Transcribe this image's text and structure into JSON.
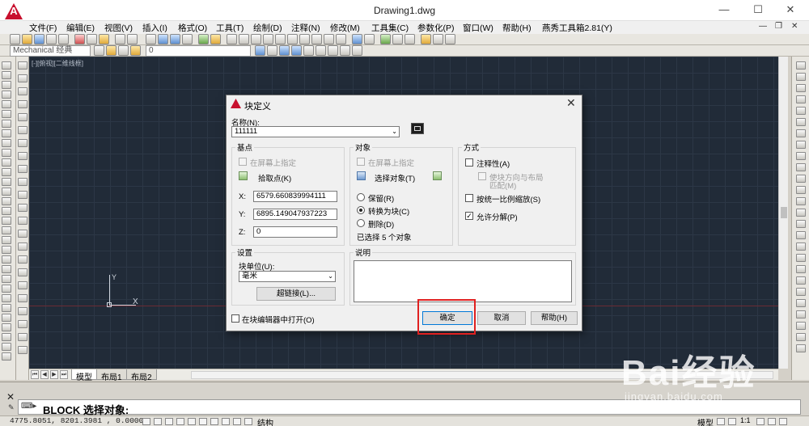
{
  "window": {
    "title": "Drawing1.dwg",
    "minimize": "—",
    "maximize": "☐",
    "close": "✕",
    "logo": "A"
  },
  "menu": {
    "items": [
      "文件(F)",
      "编辑(E)",
      "视图(V)",
      "插入(I)",
      "格式(O)",
      "工具(T)",
      "绘制(D)",
      "注释(N)",
      "修改(M)",
      "工具集(C)",
      "参数化(P)",
      "窗口(W)",
      "帮助(H)",
      "燕秀工具箱2.81(Y)"
    ],
    "doc_min": "—",
    "doc_restore": "❐",
    "doc_close": "✕"
  },
  "toolbar": {
    "workspace": "Mechanical 经典",
    "layer": "0"
  },
  "canvas": {
    "viewport_label": "[-][俯视][二维线框]",
    "ucs_y": "Y",
    "ucs_x": "X"
  },
  "layout_tabs": [
    "模型",
    "布局1",
    "布局2"
  ],
  "command": {
    "text": "BLOCK 选择对象:"
  },
  "status": {
    "coords": "4775.8051,  8201.3981 , 0.0000",
    "model_label": "模型",
    "struct_label": "结构",
    "scale": "1:1"
  },
  "watermark": {
    "logo": "Bai经验",
    "url": "jingyan.baidu.com"
  },
  "dialog": {
    "title": "块定义",
    "close": "✕",
    "name_label": "名称(N):",
    "name_value": "111111",
    "base_point": {
      "title": "基点",
      "specify_on_screen": "在屏幕上指定",
      "pick_point": "拾取点(K)",
      "x_label": "X:",
      "x_value": "6579.660839994111",
      "y_label": "Y:",
      "y_value": "6895.149047937223",
      "z_label": "Z:",
      "z_value": "0"
    },
    "objects": {
      "title": "对象",
      "specify_on_screen": "在屏幕上指定",
      "select_objects": "选择对象(T)",
      "retain": "保留(R)",
      "convert": "转换为块(C)",
      "delete": "删除(D)",
      "selected_count": "已选择 5 个对象"
    },
    "behavior": {
      "title": "方式",
      "annotative": "注释性(A)",
      "match_orientation": "使块方向与布局",
      "match_orientation_2": "匹配(M)",
      "scale_uniformly": "按统一比例缩放(S)",
      "allow_exploding": "允许分解(P)"
    },
    "settings": {
      "title": "设置",
      "block_unit_label": "块单位(U):",
      "block_unit_value": "毫米",
      "hyperlink": "超链接(L)..."
    },
    "description": {
      "title": "说明",
      "value": ""
    },
    "open_in_editor": "在块编辑器中打开(O)",
    "ok": "确定",
    "cancel": "取消",
    "help": "帮助(H)"
  }
}
